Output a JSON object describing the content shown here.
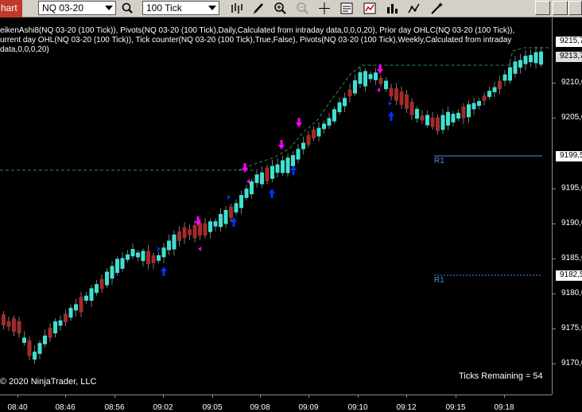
{
  "toolbar": {
    "chart_tab": "hart",
    "instrument": "NQ 03-20",
    "bar_type": "100 Tick",
    "icons": [
      "bar-style-icon",
      "draw-pencil-icon",
      "zoom-in-icon",
      "zoom-out-icon",
      "crosshair-icon",
      "properties-icon",
      "strategies-icon",
      "indicators-icon",
      "scale-icon",
      "magic-icon"
    ]
  },
  "indicators": {
    "line1": "eikenAshi8(NQ 03-20 (100 Tick)), Pivots(NQ 03-20 (100 Tick),Daily,Calculated from intraday data,0,0,0,20), Prior day OHLC(NQ 03-20 (100 Tick)),",
    "line2": "urrent day OHL(NQ 03-20 (100 Tick)), Tick counter(NQ 03-20 (100 Tick),True,False), Pivots(NQ 03-20 (100 Tick),Weekly,Calculated from intraday",
    "line3": "data,0,0,0,20)"
  },
  "price_axis": {
    "labels": [
      "9210,0",
      "9205,0",
      "9195,0",
      "9190,0",
      "9185,0",
      "9180,0",
      "9175,0",
      "9170,0"
    ],
    "box_high": "9215,7",
    "box_last": "9213,7",
    "box_r1_daily": "9199,5",
    "box_r1_weekly": "9182,5"
  },
  "time_axis": {
    "labels": [
      "08:40",
      "08:46",
      "08:56",
      "09:02",
      "09:05",
      "09:08",
      "09:09",
      "09:10",
      "09:12",
      "09:15",
      "09:18"
    ]
  },
  "annotations": {
    "r1_daily": "R1",
    "r1_weekly": "R1",
    "copyright": "© 2020 NinjaTrader, LLC",
    "ticks_remaining": "Ticks Remaining = 54"
  },
  "colors": {
    "up": "#40e0d0",
    "down": "#a52a2a",
    "pivot": "#2e8b57",
    "r1": "#4a90e2",
    "arrow_up": "#0033ff",
    "arrow_down": "#ff00ff"
  }
}
